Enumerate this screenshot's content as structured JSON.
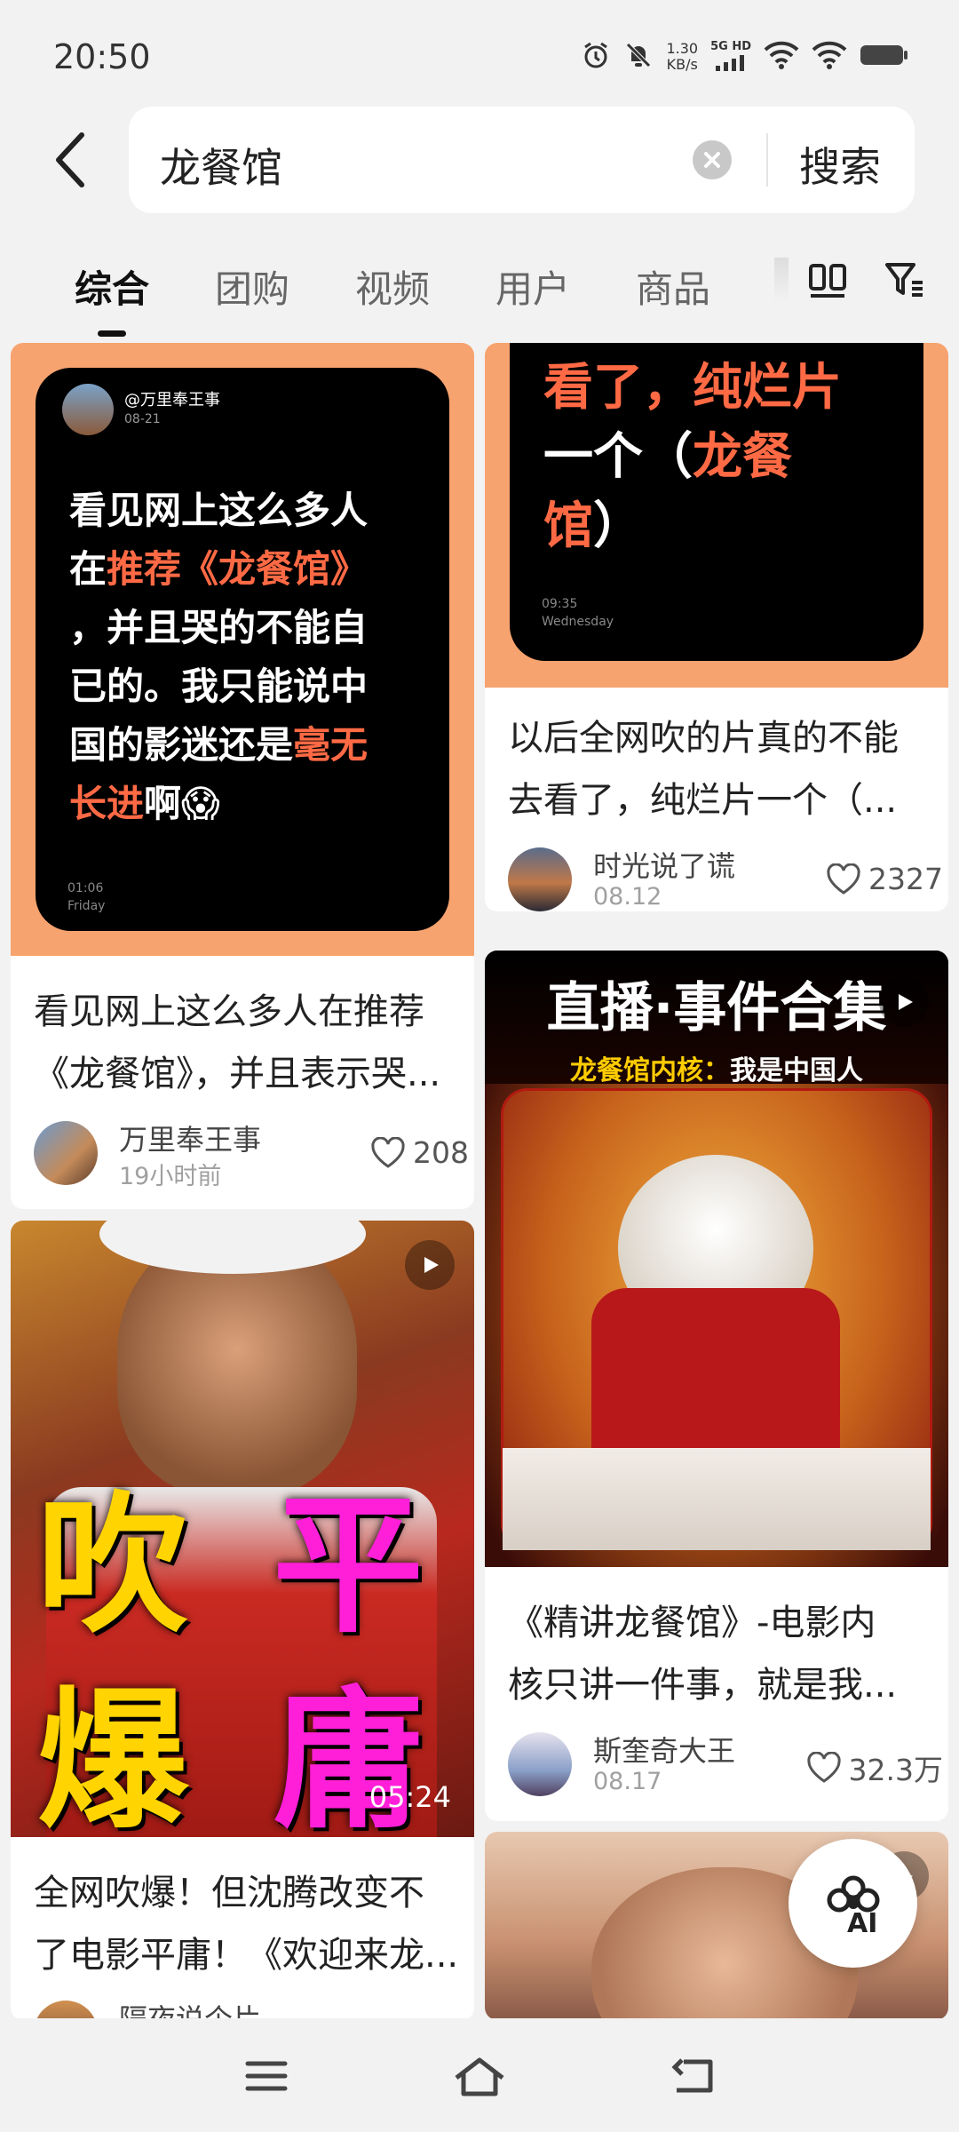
{
  "status": {
    "time": "20:50",
    "net_speed_value": "1.30",
    "net_speed_unit": "KB/s",
    "signal_label": "5G HD"
  },
  "search": {
    "query": "龙餐馆",
    "submit_label": "搜索"
  },
  "tabs": [
    "综合",
    "团购",
    "视频",
    "用户",
    "商品"
  ],
  "posts": {
    "p1": {
      "cover_handle": "@万里奉王事",
      "cover_date": "08-21",
      "cover_line1": "看见网上这么多人",
      "cover_line2a": "在",
      "cover_line2b": "推荐《龙餐馆》",
      "cover_line3": "，并且哭的不能自",
      "cover_line4": "已的。我只能说中",
      "cover_line5a": "国的影迷还是",
      "cover_line5b": "毫无",
      "cover_line6a": "长进",
      "cover_line6b": "啊😱",
      "cover_clock": "01:06",
      "cover_day": "Friday",
      "title_line1": "看见网上这么多人在推荐",
      "title_line2": "《龙餐馆》，并且表示哭...",
      "author": "万里奉王事",
      "date": "19小时前",
      "likes": "208"
    },
    "p2": {
      "cover_line1a": "看了，",
      "cover_line1b": "纯烂片",
      "cover_line2a": "一个（",
      "cover_line2b": "龙餐",
      "cover_line3": "馆",
      "cover_line3b": "）",
      "cover_clock": "09:35",
      "cover_day": "Wednesday",
      "title_line1": "以后全网吹的片真的不能",
      "title_line2": "去看了，纯烂片一个（...",
      "author": "时光说了谎",
      "date": "08.12",
      "likes": "2327"
    },
    "p3": {
      "cover_big1": "吹",
      "cover_big2": "平",
      "cover_big3": "爆",
      "cover_big4": "庸",
      "duration": "05:24",
      "title_line1": "全网吹爆！但沈腾改变不",
      "title_line2": "了电影平庸！《欢迎来龙...",
      "author": "隔夜说个片"
    },
    "p4": {
      "cover_heading": "直播·事件合集",
      "cover_sub_a": "龙餐馆内核：",
      "cover_sub_b": "我是中国人",
      "title_line1": "《精讲龙餐馆》-电影内",
      "title_line2": "核只讲一件事，就是我...",
      "author": "斯奎奇大王",
      "date": "08.17",
      "likes": "32.3万"
    }
  },
  "ai_button_label": "AI",
  "colors": {
    "background": "#f2f2f2",
    "highlight": "#ff6a45",
    "cover_frame": "#f7a36f",
    "magenta": "#ff1fd8",
    "yellow": "#ffd400"
  }
}
